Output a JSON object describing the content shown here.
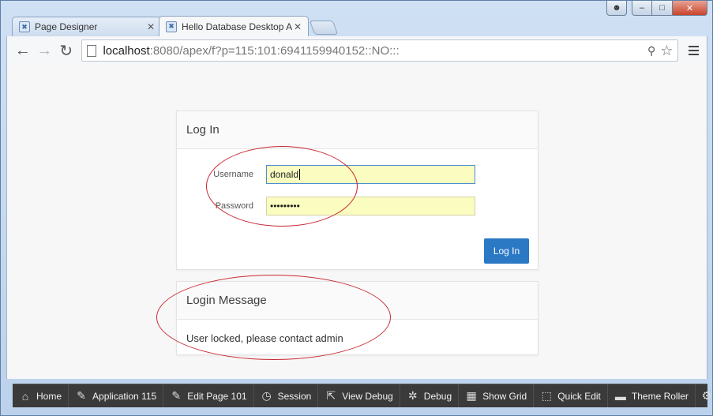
{
  "tabs": [
    {
      "title": "Page Designer",
      "active": false
    },
    {
      "title": "Hello Database Desktop A",
      "active": true
    }
  ],
  "address": {
    "host": "localhost",
    "path": ":8080/apex/f?p=115:101:6941159940152::NO:::"
  },
  "login_region": {
    "title": "Log In",
    "username_label": "Username",
    "username_value": "donald",
    "password_label": "Password",
    "password_value": "•••••••••",
    "button_label": "Log In"
  },
  "message_region": {
    "title": "Login Message",
    "text": "User locked, please contact admin"
  },
  "dev_toolbar": [
    {
      "label": "Home",
      "icon": "home-icon",
      "glyph": "⌂"
    },
    {
      "label": "Application 115",
      "icon": "edit-icon",
      "glyph": "✎"
    },
    {
      "label": "Edit Page 101",
      "icon": "edit-icon",
      "glyph": "✎"
    },
    {
      "label": "Session",
      "icon": "clock-icon",
      "glyph": "◷"
    },
    {
      "label": "View Debug",
      "icon": "external-icon",
      "glyph": "⇱"
    },
    {
      "label": "Debug",
      "icon": "bug-icon",
      "glyph": "✲"
    },
    {
      "label": "Show Grid",
      "icon": "grid-icon",
      "glyph": "▦"
    },
    {
      "label": "Quick Edit",
      "icon": "cursor-icon",
      "glyph": "⬚"
    },
    {
      "label": "Theme Roller",
      "icon": "paint-roller-icon",
      "glyph": "▬"
    }
  ],
  "colors": {
    "button_blue": "#2b78c5",
    "autofill_yellow": "#fafcc0",
    "annotation_red": "#c82832"
  }
}
